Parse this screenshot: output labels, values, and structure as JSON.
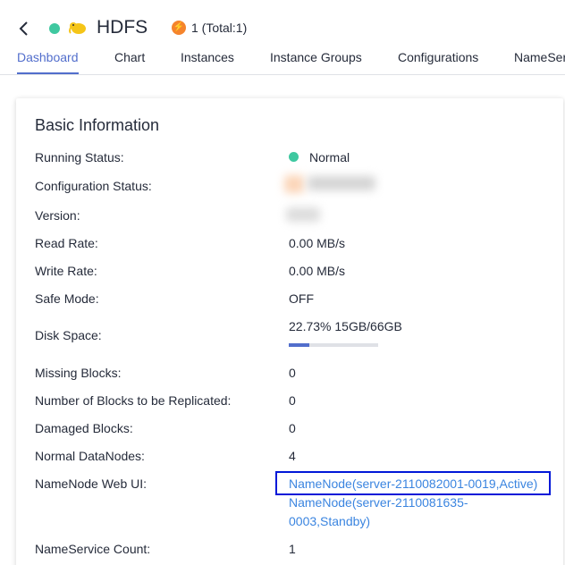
{
  "header": {
    "title": "HDFS",
    "alarm_text": "1 (Total:1)"
  },
  "tabs": [
    {
      "label": "Dashboard",
      "active": true
    },
    {
      "label": "Chart"
    },
    {
      "label": "Instances"
    },
    {
      "label": "Instance Groups"
    },
    {
      "label": "Configurations"
    },
    {
      "label": "NameServ"
    }
  ],
  "basic_info": {
    "title": "Basic Information",
    "rows": [
      {
        "label": "Running Status:",
        "value": "Normal"
      },
      {
        "label": "Configuration Status:",
        "value": ""
      },
      {
        "label": "Version:",
        "value": ""
      },
      {
        "label": "Read Rate:",
        "value": "0.00 MB/s"
      },
      {
        "label": "Write Rate:",
        "value": "0.00 MB/s"
      },
      {
        "label": "Safe Mode:",
        "value": "OFF"
      },
      {
        "label": "Disk Space:",
        "value": "22.73% 15GB/66GB"
      },
      {
        "label": "Missing Blocks:",
        "value": "0"
      },
      {
        "label": "Number of Blocks to be Replicated:",
        "value": "0"
      },
      {
        "label": "Damaged Blocks:",
        "value": "0"
      },
      {
        "label": "Normal DataNodes:",
        "value": "4"
      },
      {
        "label": "NameNode Web UI:",
        "value": ""
      },
      {
        "label": "NameService Count:",
        "value": "1"
      }
    ],
    "disk_usage_percent": 22.73,
    "namenode_links": [
      "NameNode(server-2110082001-0019,Active)",
      "NameNode(server-2110081635-",
      "0003,Standby)"
    ]
  },
  "colors": {
    "accent": "#526ecc",
    "status_normal": "#3fc8a0",
    "link": "#3b85e0",
    "alarm": "#f5842c",
    "highlight_box": "#0018d8"
  }
}
